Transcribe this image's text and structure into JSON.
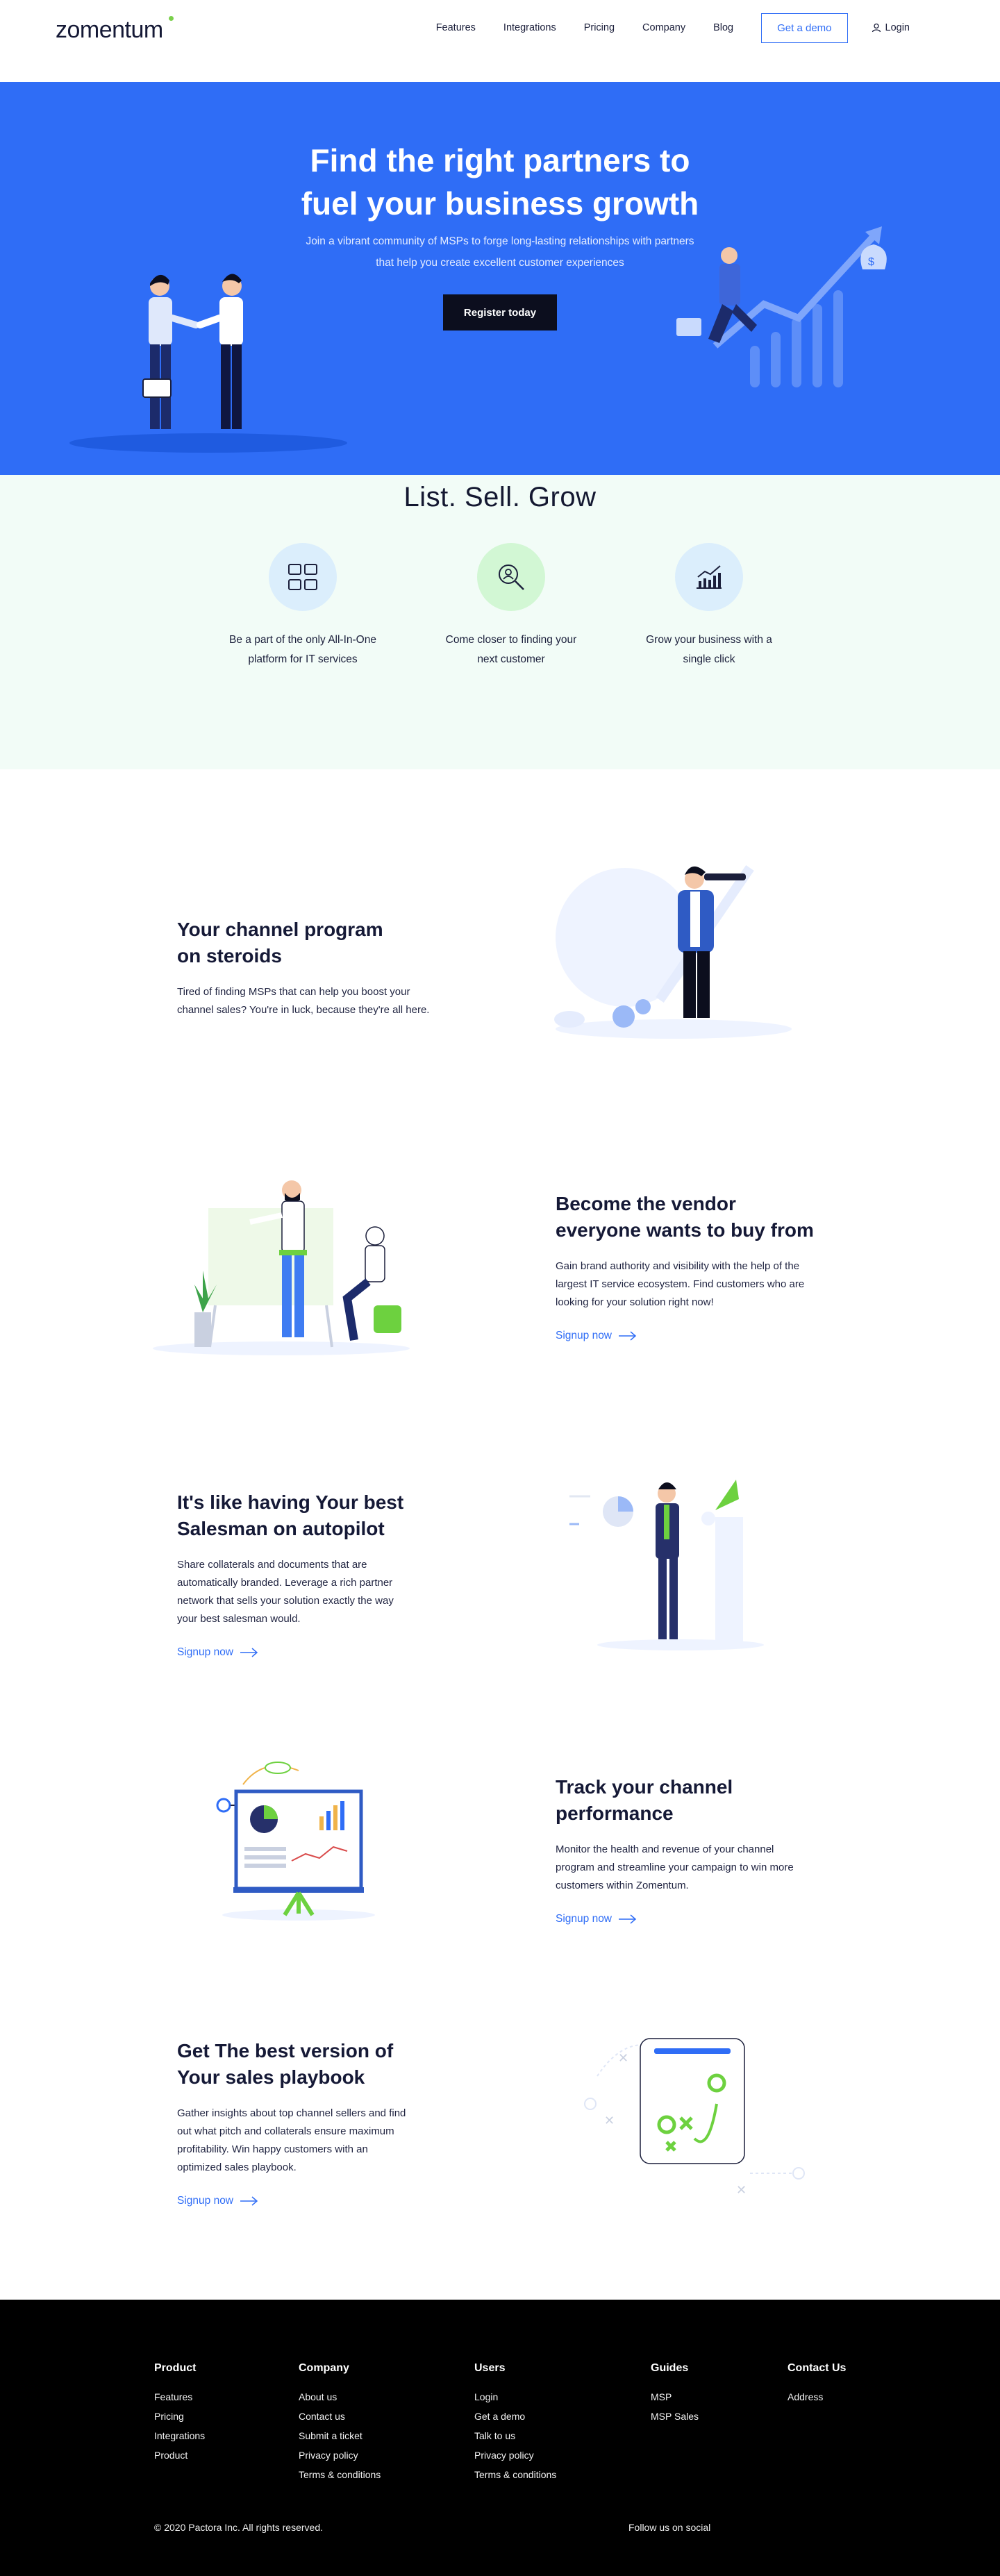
{
  "brand": {
    "name": "zomentum",
    "accent": "#2f6df6",
    "dot_color": "#7ad04b"
  },
  "nav": {
    "links": [
      "Features",
      "Integrations",
      "Pricing",
      "Company",
      "Blog"
    ],
    "demo_label": "Get a demo",
    "login_label": "Login",
    "login_icon": "user-icon"
  },
  "hero": {
    "title_line1": "Find the right partners to",
    "title_line2": "fuel your business growth",
    "subtitle_line1": "Join a vibrant community of MSPs to forge long-lasting relationships with partners",
    "subtitle_line2": "that help you create excellent customer experiences",
    "cta_label": "Register today",
    "bg_color": "#2f6df6"
  },
  "values": {
    "heading": "List. Sell. Grow",
    "items": [
      {
        "icon": "grid-apps-icon",
        "line1": "Be a part of the only  All-In-One",
        "line2": "platform for IT services",
        "circle": "#dbeefc"
      },
      {
        "icon": "search-person-icon",
        "line1": "Come closer to finding your",
        "line2": "next customer",
        "circle": "#d2f7d4"
      },
      {
        "icon": "growth-chart-icon",
        "line1": "Grow your business with a",
        "line2": "single click",
        "circle": "#dbeefc"
      }
    ]
  },
  "features": [
    {
      "title_line1": "Your channel program",
      "title_line2": "on steroids",
      "body": [
        "Tired of finding MSPs that can help you boost your",
        "channel sales?  You're in luck, because they're all here."
      ],
      "cta": ""
    },
    {
      "title_line1": "Become the vendor",
      "title_line2": "everyone wants to buy from",
      "body": [
        "Gain brand authority and visibility with the help of the",
        "largest IT service ecosystem. Find customers who are",
        "looking for your solution right now!"
      ],
      "cta": "Signup now"
    },
    {
      "title_line1": "It's like having Your best",
      "title_line2": "Salesman on autopilot",
      "body": [
        "Share collaterals and documents that are",
        "automatically branded. Leverage a rich partner",
        "network that sells your solution exactly the way",
        "your best salesman would."
      ],
      "cta": "Signup now"
    },
    {
      "title_line1": "Track your channel",
      "title_line2": "performance",
      "body": [
        "Monitor the health and revenue of your channel",
        "program and streamline your campaign to win more",
        "customers within Zomentum."
      ],
      "cta": "Signup now"
    },
    {
      "title_line1": "Get The best version of",
      "title_line2": "Your sales playbook",
      "body": [
        "Gather insights about top channel sellers and find",
        "out what pitch and collaterals ensure maximum",
        "profitability. Win happy customers with an",
        "optimized sales playbook."
      ],
      "cta": "Signup now"
    }
  ],
  "footer": {
    "columns": [
      {
        "title": "Product",
        "links": [
          "Features",
          "Pricing",
          "Integrations",
          "Product"
        ]
      },
      {
        "title": "Company",
        "links": [
          "About us",
          "Contact us",
          "Submit a ticket",
          "Privacy policy",
          "Terms & conditions"
        ]
      },
      {
        "title": "Users",
        "links": [
          "Login",
          "Get a demo",
          "Talk to us",
          "Privacy policy",
          "Terms & conditions"
        ]
      },
      {
        "title": "Guides",
        "links": [
          "MSP",
          "MSP Sales"
        ]
      },
      {
        "title": "Contact Us",
        "links": [
          "Address"
        ]
      }
    ],
    "copyright": "© 2020 Pactora Inc. All rights reserved.",
    "follow": "Follow us on social"
  }
}
